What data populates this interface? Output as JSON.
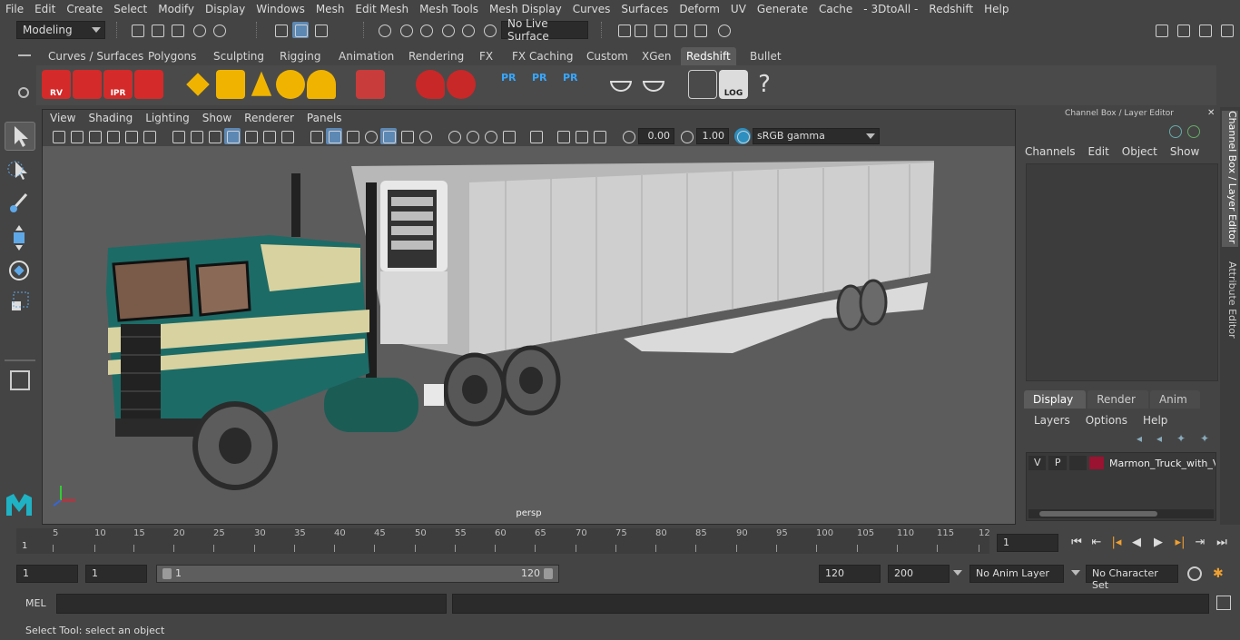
{
  "menubar": [
    "File",
    "Edit",
    "Create",
    "Select",
    "Modify",
    "Display",
    "Windows",
    "Mesh",
    "Edit Mesh",
    "Mesh Tools",
    "Mesh Display",
    "Curves",
    "Surfaces",
    "Deform",
    "UV",
    "Generate",
    "Cache",
    "- 3DtoAll -",
    "Redshift",
    "Help"
  ],
  "status": {
    "mode": "Modeling",
    "live_surface": "No Live Surface"
  },
  "shelf": {
    "tabs": [
      "Curves / Surfaces",
      "Polygons",
      "Sculpting",
      "Rigging",
      "Animation",
      "Rendering",
      "FX",
      "FX Caching",
      "Custom",
      "XGen",
      "Redshift",
      "Bullet"
    ],
    "active_tab": "Redshift",
    "icon_labels": [
      "RV",
      "IPR",
      "PR",
      "PR",
      "PR",
      "LOG",
      "?"
    ]
  },
  "viewport": {
    "menu": [
      "View",
      "Shading",
      "Lighting",
      "Show",
      "Renderer",
      "Panels"
    ],
    "exposure": "0.00",
    "gamma": "1.00",
    "color_space": "sRGB gamma",
    "camera_label": "persp"
  },
  "channel_box": {
    "title": "Channel Box / Layer Editor",
    "menu": [
      "Channels",
      "Edit",
      "Object",
      "Show"
    ],
    "layer_tabs": [
      "Display",
      "Render",
      "Anim"
    ],
    "layer_menu": [
      "Layers",
      "Options",
      "Help"
    ],
    "layer": {
      "v": "V",
      "p": "P",
      "name": "Marmon_Truck_with_V"
    }
  },
  "side_tabs": [
    "Channel Box / Layer Editor",
    "Attribute Editor"
  ],
  "timeline": {
    "ticks": [
      "5",
      "10",
      "15",
      "20",
      "25",
      "30",
      "35",
      "40",
      "45",
      "50",
      "55",
      "60",
      "65",
      "70",
      "75",
      "80",
      "85",
      "90",
      "95",
      "100",
      "105",
      "110",
      "115",
      "12"
    ],
    "current_frame": "1",
    "frame_field": "1"
  },
  "range": {
    "start": "1",
    "start2": "1",
    "slider_start": "1",
    "slider_end": "120",
    "end": "120",
    "end2": "200",
    "anim_layer": "No Anim Layer",
    "char_set": "No Character Set"
  },
  "command": {
    "lang": "MEL"
  },
  "help_line": "Select Tool: select an object",
  "colors": {
    "layer_color": "#9a1331",
    "active_tab": "#5a5a5a",
    "accent": "#5d88b4"
  }
}
